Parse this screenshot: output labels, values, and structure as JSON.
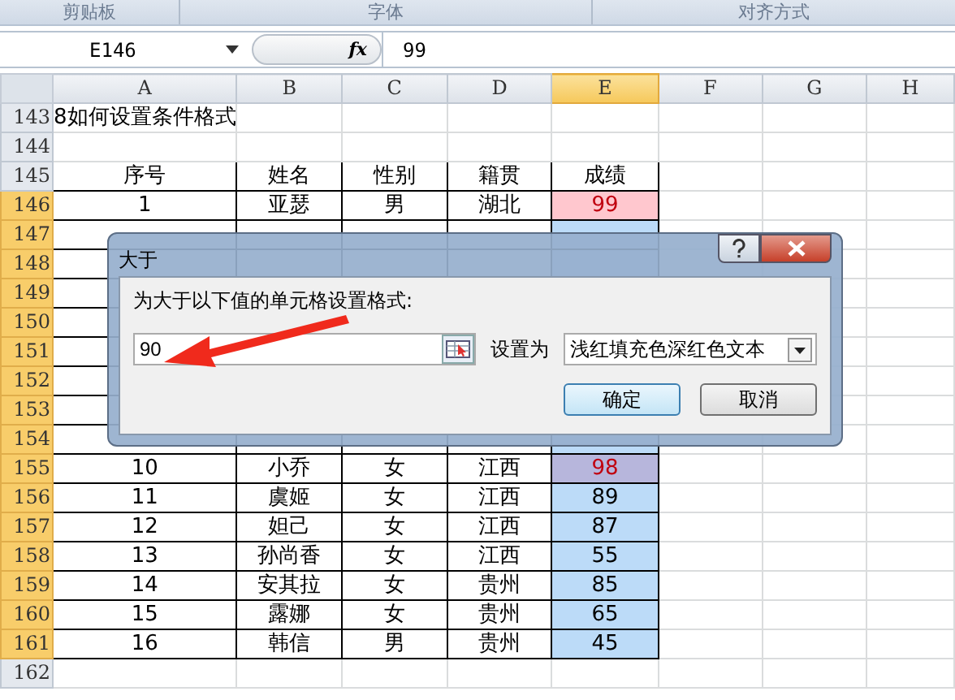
{
  "ribbon_groups": [
    {
      "label": "剪贴板"
    },
    {
      "label": "字体"
    },
    {
      "label": "对齐方式"
    }
  ],
  "formula_bar": {
    "name_box": "E146",
    "fx": "fx",
    "value": "99"
  },
  "columns": [
    {
      "label": "A",
      "selected": false
    },
    {
      "label": "B",
      "selected": false
    },
    {
      "label": "C",
      "selected": false
    },
    {
      "label": "D",
      "selected": false
    },
    {
      "label": "E",
      "selected": true
    },
    {
      "label": "F",
      "selected": false
    },
    {
      "label": "G",
      "selected": false
    },
    {
      "label": "H",
      "selected": false
    }
  ],
  "rows": [
    {
      "number": "143",
      "selected": false,
      "kind": "title",
      "text": "8如何设置条件格式"
    },
    {
      "number": "144",
      "selected": false,
      "kind": "blank"
    },
    {
      "number": "145",
      "selected": false,
      "kind": "data",
      "cells": [
        "序号",
        "姓名",
        "性别",
        "籍贯",
        "成绩"
      ],
      "score_selected": false,
      "format_hit": false
    },
    {
      "number": "146",
      "selected": true,
      "kind": "data",
      "cells": [
        "1",
        "亚瑟",
        "男",
        "湖北",
        "99"
      ],
      "score_selected": false,
      "format_hit": true
    },
    {
      "number": "147",
      "selected": true,
      "kind": "hidden"
    },
    {
      "number": "148",
      "selected": true,
      "kind": "hidden"
    },
    {
      "number": "149",
      "selected": true,
      "kind": "hidden"
    },
    {
      "number": "150",
      "selected": true,
      "kind": "hidden"
    },
    {
      "number": "151",
      "selected": true,
      "kind": "hidden"
    },
    {
      "number": "152",
      "selected": true,
      "kind": "hidden"
    },
    {
      "number": "153",
      "selected": true,
      "kind": "hidden"
    },
    {
      "number": "154",
      "selected": true,
      "kind": "hidden"
    },
    {
      "number": "155",
      "selected": true,
      "kind": "data",
      "cells": [
        "10",
        "小乔",
        "女",
        "江西",
        "98"
      ],
      "score_selected": true,
      "format_hit": true
    },
    {
      "number": "156",
      "selected": true,
      "kind": "data",
      "cells": [
        "11",
        "虞姬",
        "女",
        "江西",
        "89"
      ],
      "score_selected": true,
      "format_hit": false
    },
    {
      "number": "157",
      "selected": true,
      "kind": "data",
      "cells": [
        "12",
        "妲己",
        "女",
        "江西",
        "87"
      ],
      "score_selected": true,
      "format_hit": false
    },
    {
      "number": "158",
      "selected": true,
      "kind": "data",
      "cells": [
        "13",
        "孙尚香",
        "女",
        "江西",
        "55"
      ],
      "score_selected": true,
      "format_hit": false
    },
    {
      "number": "159",
      "selected": true,
      "kind": "data",
      "cells": [
        "14",
        "安其拉",
        "女",
        "贵州",
        "85"
      ],
      "score_selected": true,
      "format_hit": false
    },
    {
      "number": "160",
      "selected": true,
      "kind": "data",
      "cells": [
        "15",
        "露娜",
        "女",
        "贵州",
        "65"
      ],
      "score_selected": true,
      "format_hit": false
    },
    {
      "number": "161",
      "selected": true,
      "kind": "data",
      "cells": [
        "16",
        "韩信",
        "男",
        "贵州",
        "45"
      ],
      "score_selected": true,
      "format_hit": false
    },
    {
      "number": "162",
      "selected": false,
      "kind": "blank"
    }
  ],
  "dialog": {
    "title": "大于",
    "prompt": "为大于以下值的单元格设置格式:",
    "value": "90",
    "format_label": "设置为",
    "format_value": "浅红填充色深红色文本",
    "buttons": [
      {
        "label": "确定",
        "default": true
      },
      {
        "label": "取消",
        "default": false
      }
    ]
  }
}
